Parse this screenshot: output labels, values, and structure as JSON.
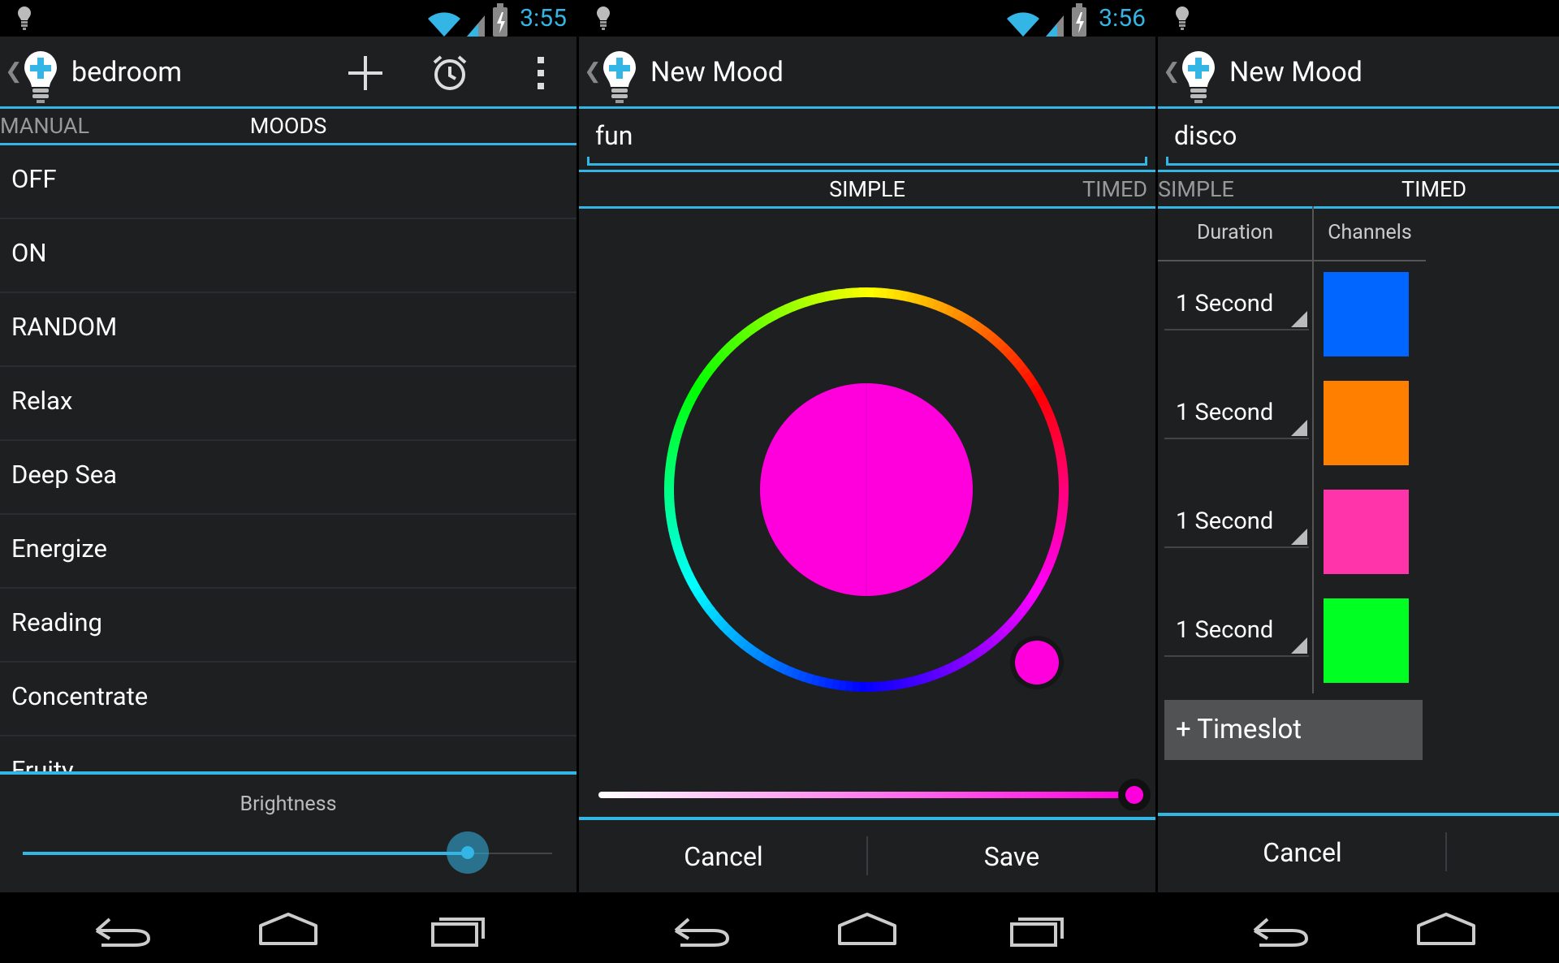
{
  "status": [
    {
      "time": "3:55"
    },
    {
      "time": "3:56"
    },
    {
      "time": ""
    }
  ],
  "screen1": {
    "title": "bedroom",
    "tabs": [
      "MANUAL",
      "MOODS"
    ],
    "moods": [
      "OFF",
      "ON",
      "RANDOM",
      "Relax",
      "Deep Sea",
      "Energize",
      "Reading",
      "Concentrate",
      "Fruity"
    ],
    "brightness_label": "Brightness",
    "brightness_value": 0.84
  },
  "screen2": {
    "title": "New Mood",
    "name_value": "fun",
    "tabs": [
      "SIMPLE",
      "TIMED"
    ],
    "selected_color": "#ff00dd",
    "saturation_value": 1.0,
    "cancel": "Cancel",
    "save": "Save"
  },
  "screen3": {
    "title": "New Mood",
    "name_value": "disco",
    "tabs": [
      "SIMPLE",
      "TIMED"
    ],
    "col_duration": "Duration",
    "col_channels": "Channels",
    "slots": [
      {
        "duration": "1 Second",
        "color": "#0066ff"
      },
      {
        "duration": "1 Second",
        "color": "#ff8000"
      },
      {
        "duration": "1 Second",
        "color": "#ff33aa"
      },
      {
        "duration": "1 Second",
        "color": "#00ff22"
      }
    ],
    "add_timeslot": "+ Timeslot",
    "cancel": "Cancel"
  },
  "colors": {
    "accent": "#33b5e5",
    "background": "#1d1f21"
  },
  "icons": [
    "bulb-icon",
    "wifi-icon",
    "signal-icon",
    "battery-icon",
    "add-icon",
    "alarm-icon",
    "overflow-menu-icon",
    "back-icon",
    "home-icon",
    "recents-icon"
  ]
}
